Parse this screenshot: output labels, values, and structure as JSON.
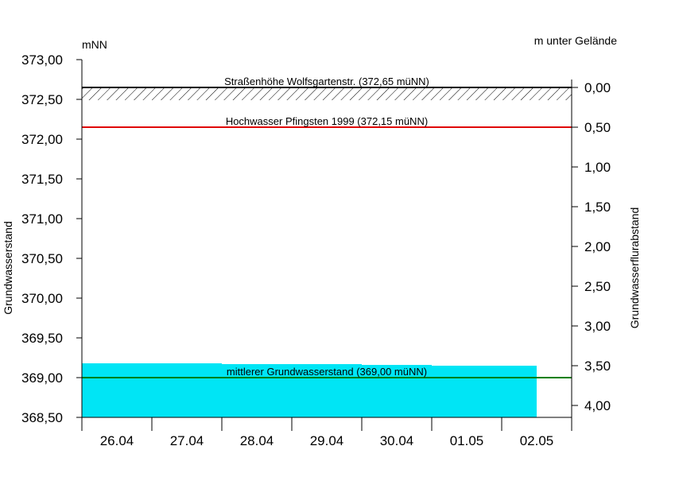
{
  "chart_data": {
    "type": "area",
    "left_unit": "mNN",
    "right_unit": "m unter Gelände",
    "ylabel": "Grundwasserstand",
    "ylabel_right": "Grundwasserflurabstand",
    "ylim": [
      368.5,
      373.0
    ],
    "y_ticks": [
      "373,00",
      "372,50",
      "372,00",
      "371,50",
      "371,00",
      "370,50",
      "370,00",
      "369,50",
      "369,00",
      "368,50"
    ],
    "y_tick_values": [
      373.0,
      372.5,
      372.0,
      371.5,
      371.0,
      370.5,
      370.0,
      369.5,
      369.0,
      368.5
    ],
    "right_ticks": [
      "0,00",
      "0,50",
      "1,00",
      "1,50",
      "2,00",
      "2,50",
      "3,00",
      "3,50",
      "4,00"
    ],
    "right_tick_values": [
      0.0,
      0.5,
      1.0,
      1.5,
      2.0,
      2.5,
      3.0,
      3.5,
      4.0
    ],
    "ground_level": 372.65,
    "categories": [
      "26.04",
      "27.04",
      "28.04",
      "29.04",
      "30.04",
      "01.05",
      "02.05"
    ],
    "series": [
      {
        "name": "",
        "x": [
          0,
          1,
          2,
          3,
          4,
          5,
          6,
          6.5
        ],
        "values": [
          369.18,
          369.18,
          369.17,
          369.17,
          369.16,
          369.15,
          369.15,
          369.15
        ],
        "color": "#00e5f5"
      }
    ],
    "reference_lines": [
      {
        "label": "Straßenhöhe Wolfsgartenstr. (372,65 müNN)",
        "value": 372.65,
        "color": "#000000",
        "hatched": true
      },
      {
        "label": "Hochwasser Pfingsten 1999 (372,15 müNN)",
        "value": 372.15,
        "color": "#e00000"
      },
      {
        "label": "mittlerer Grundwasserstand (369,00 müNN)",
        "value": 369.0,
        "color": "#008000"
      }
    ]
  }
}
